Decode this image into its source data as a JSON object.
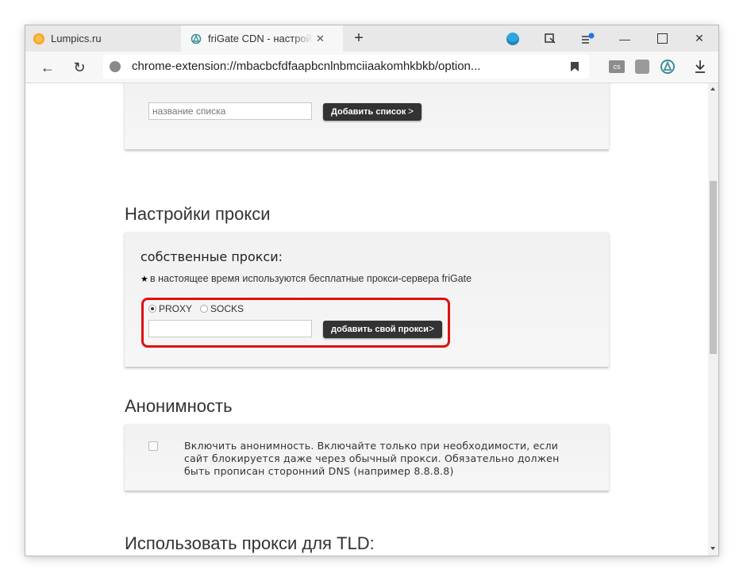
{
  "tabs": [
    {
      "title": "Lumpics.ru",
      "icon": "orange-circle-icon"
    },
    {
      "title": "friGate CDN - настройки",
      "icon": "frigate-icon",
      "close": "✕"
    }
  ],
  "new_tab": "+",
  "window_controls": {
    "minimize": "—",
    "maximize": "☐",
    "close": "✕"
  },
  "address_bar": {
    "url": "chrome-extension://mbacbcfdfaapbcnlnbmciiaakomhkbkb/option...",
    "back": "←",
    "reload": "↻"
  },
  "extensions": [
    "cs-icon",
    "puzzle-icon",
    "frigate-icon",
    "download-icon"
  ],
  "list_section": {
    "input_placeholder": "название списка",
    "button": "Добавить список"
  },
  "proxy_section": {
    "heading": "Настройки прокси",
    "subheading": "собственные прокси:",
    "note": "в настоящее время используются бесплатные прокси-сервера friGate",
    "radio_options": [
      {
        "label": "PROXY",
        "selected": true
      },
      {
        "label": "SOCKS",
        "selected": false
      }
    ],
    "input_value": "",
    "button": "добавить свой прокси",
    "highlight_color": "#e01010"
  },
  "anon_section": {
    "heading": "Анонимность",
    "checked": false,
    "text": "Включить анонимность. Включайте только при необходимости, если сайт блокируется даже через обычный прокси. Обязательно должен быть прописан сторонний DNS (например 8.8.8.8)"
  },
  "tld_section": {
    "heading": "Использовать прокси для TLD:"
  }
}
